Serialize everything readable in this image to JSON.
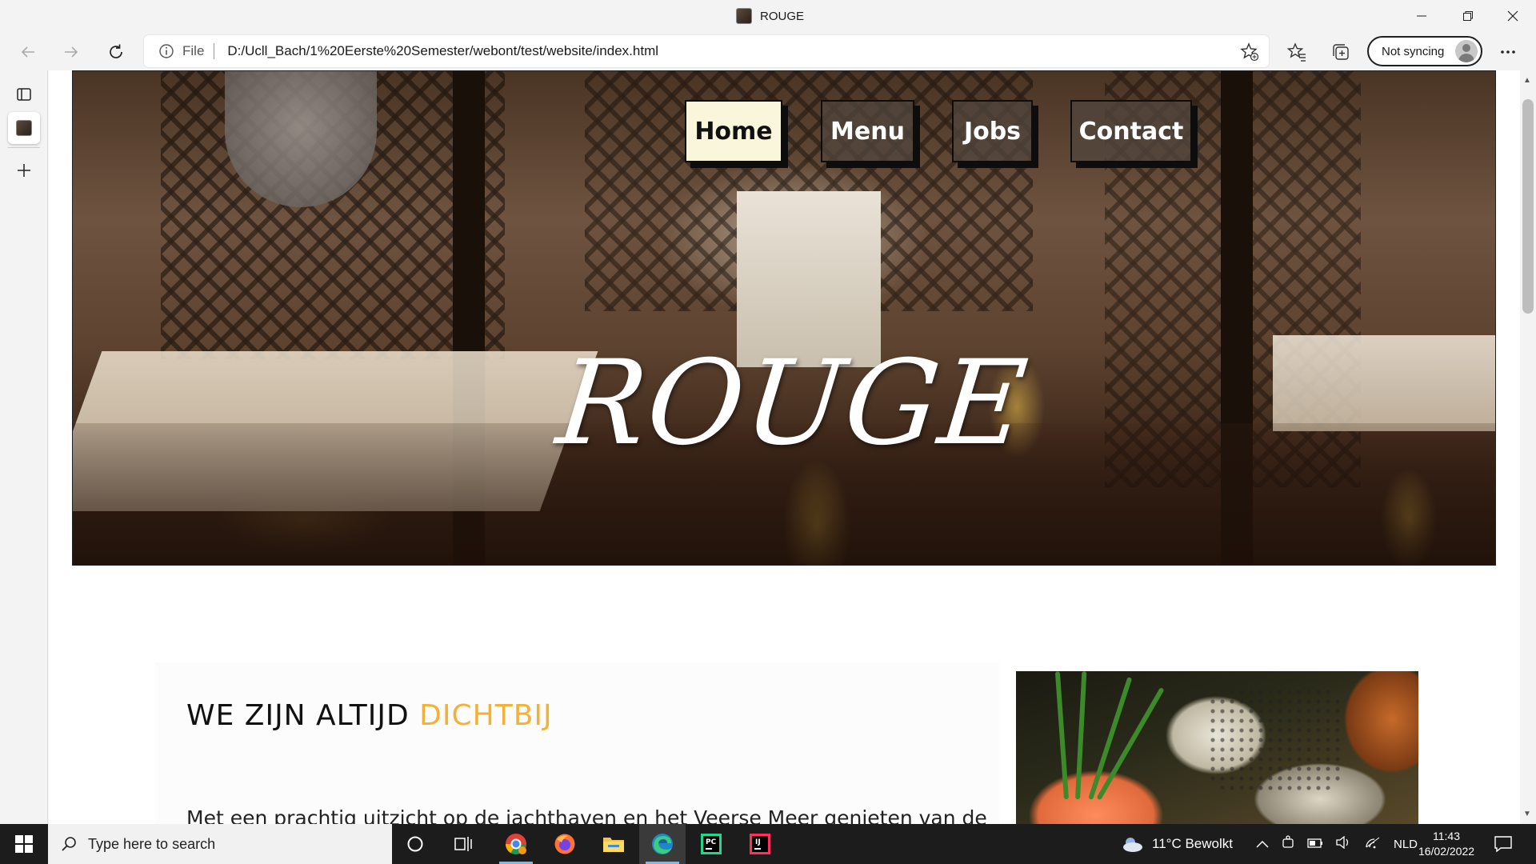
{
  "window": {
    "title": "ROUGE"
  },
  "toolbar": {
    "address_prefix": "File",
    "url": "D:/Ucll_Bach/1%20Eerste%20Semester/webont/test/website/index.html",
    "sync_label": "Not syncing"
  },
  "site": {
    "nav": [
      {
        "label": "Home",
        "active": true
      },
      {
        "label": "Menu",
        "active": false
      },
      {
        "label": "Jobs",
        "active": false
      },
      {
        "label": "Contact",
        "active": false
      }
    ],
    "brand": "ROUGE",
    "section": {
      "heading_main": "WE ZIJN ALTIJD ",
      "heading_accent": "DICHTBIJ",
      "paragraph": "Met een prachtig uitzicht op de jachthaven en het Veerse Meer genieten van de"
    },
    "colors": {
      "accent": "#f2b23a",
      "nav_active_bg": "#faf6dc"
    }
  },
  "taskbar": {
    "search_placeholder": "Type here to search",
    "weather": "11°C  Bewolkt",
    "language": "NLD",
    "time": "11:43",
    "date": "16/02/2022",
    "apps": [
      "cortana-circle",
      "task-view",
      "chrome",
      "firefox",
      "file-explorer",
      "edge",
      "pycharm",
      "intellij"
    ]
  }
}
